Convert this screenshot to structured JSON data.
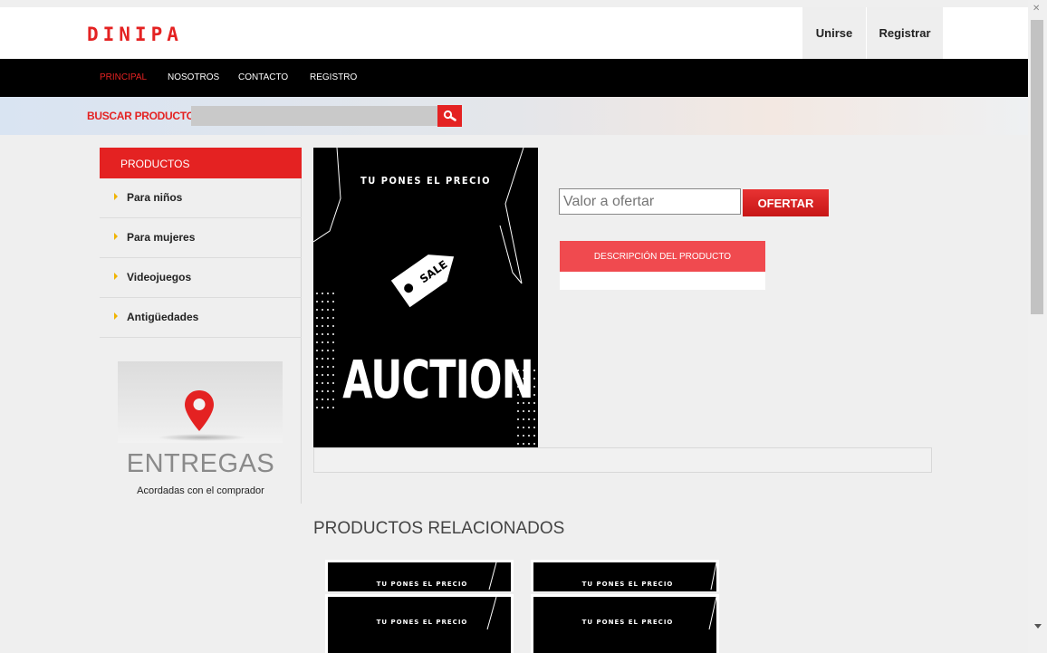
{
  "header": {
    "logo": "DINIPA",
    "join_label": "Unirse",
    "register_label": "Registrar"
  },
  "nav": {
    "items": [
      {
        "label": "PRINCIPAL",
        "active": true
      },
      {
        "label": "NOSOTROS",
        "active": false
      },
      {
        "label": "CONTACTO",
        "active": false
      },
      {
        "label": "REGISTRO",
        "active": false
      }
    ]
  },
  "search": {
    "label": "BUSCAR PRODUCTO",
    "value": "",
    "icon": "search-icon"
  },
  "sidebar": {
    "title": "PRODUCTOS",
    "items": [
      {
        "label": "Para niños"
      },
      {
        "label": "Para mujeres"
      },
      {
        "label": "Videojuegos"
      },
      {
        "label": "Antigüedades"
      }
    ],
    "promo": {
      "icon": "map-pin-icon",
      "title": "ENTREGAS",
      "subtitle": "Acordadas con el comprador"
    }
  },
  "product": {
    "image": {
      "headline": "TU PONES EL PRECIO",
      "tag_text": "SALE",
      "big_text": "AUCTION"
    },
    "offer_placeholder": "Valor a ofertar",
    "offer_button": "OFERTAR",
    "description_tab": "DESCRIPCIÓN DEL PRODUCTO"
  },
  "related": {
    "title": "PRODUCTOS RELACIONADOS",
    "items": [
      {
        "caption": "TU PONES EL PRECIO"
      },
      {
        "caption": "TU PONES EL PRECIO"
      },
      {
        "caption": "TU PONES EL PRECIO"
      },
      {
        "caption": "TU PONES EL PRECIO"
      }
    ]
  },
  "colors": {
    "accent": "#e42222",
    "nav_background": "#000000",
    "description_tab": "#f04a4f"
  }
}
